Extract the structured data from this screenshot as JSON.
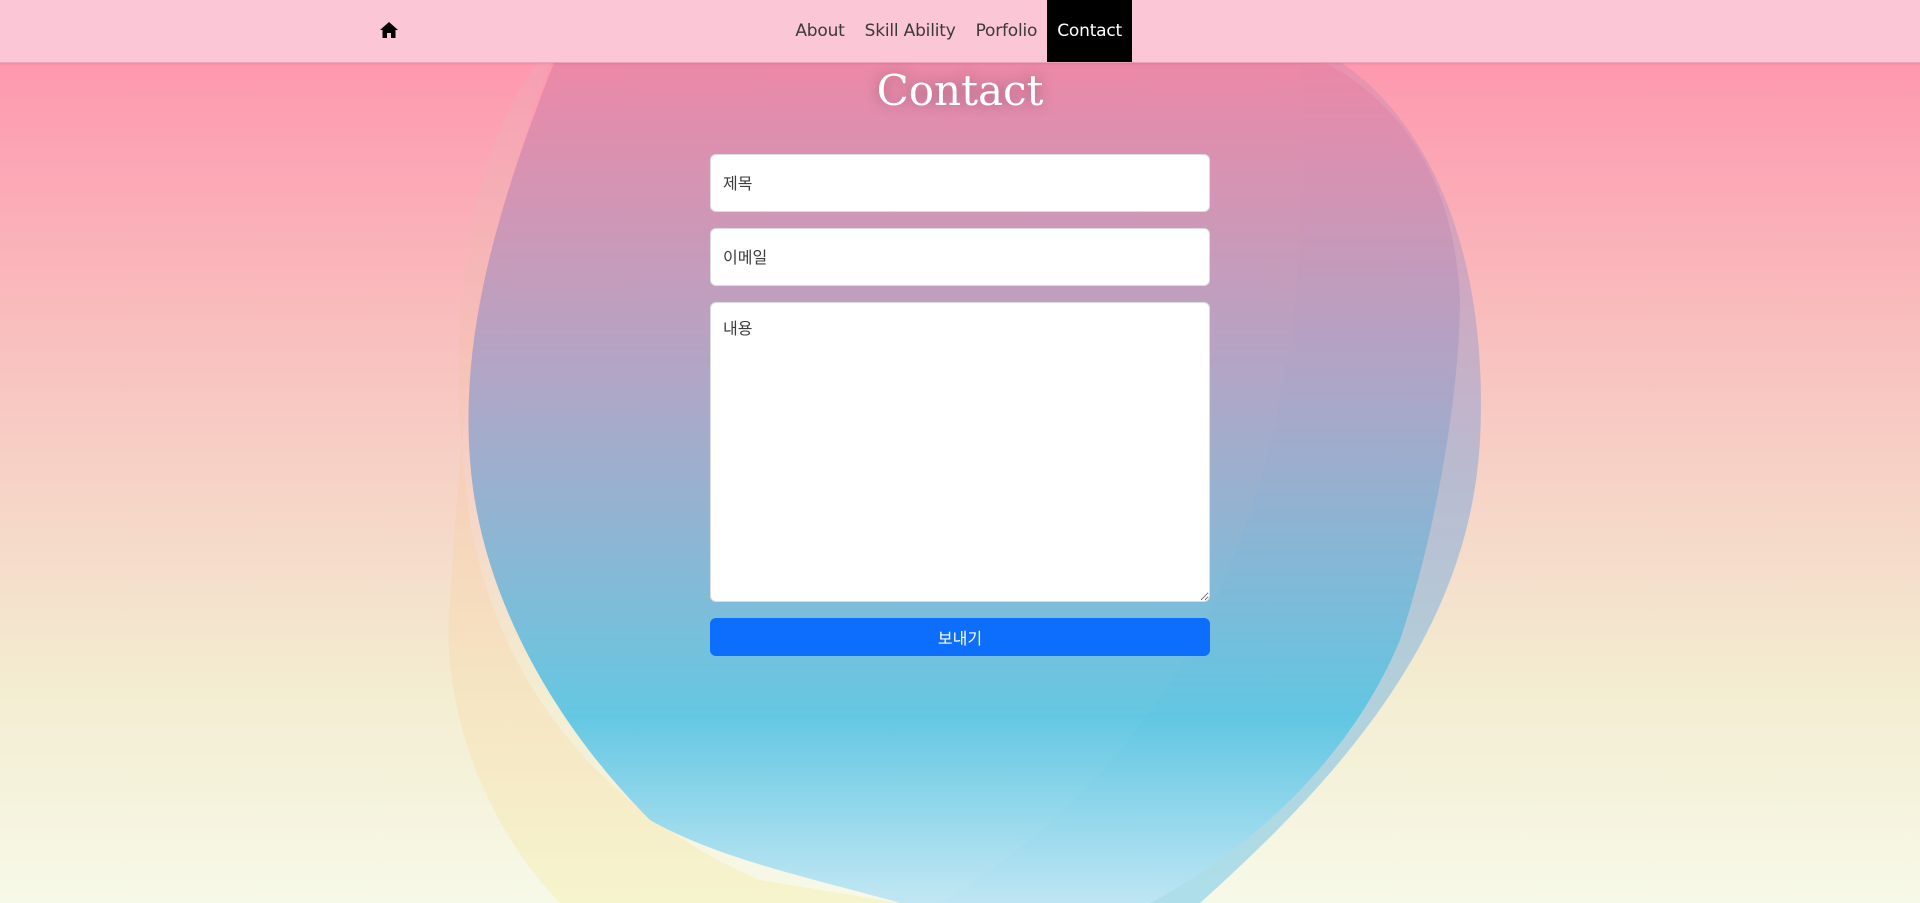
{
  "nav": {
    "home_icon": "home-icon",
    "items": [
      {
        "label": "About",
        "active": false
      },
      {
        "label": "Skill Ability",
        "active": false
      },
      {
        "label": "Porfolio",
        "active": false
      },
      {
        "label": "Contact",
        "active": true
      }
    ]
  },
  "page": {
    "title": "Contact"
  },
  "form": {
    "title_placeholder": "제목",
    "email_placeholder": "이메일",
    "content_placeholder": "내용",
    "submit_label": "보내기"
  },
  "colors": {
    "navbar_bg": "#fbc6d6",
    "active_nav_bg": "#000000",
    "button_bg": "#0d6efd",
    "background_top": "#ff8fab",
    "background_bottom": "#f7f9e8",
    "blob_top": "#e889a8",
    "blob_bottom": "#5fc7e3"
  }
}
